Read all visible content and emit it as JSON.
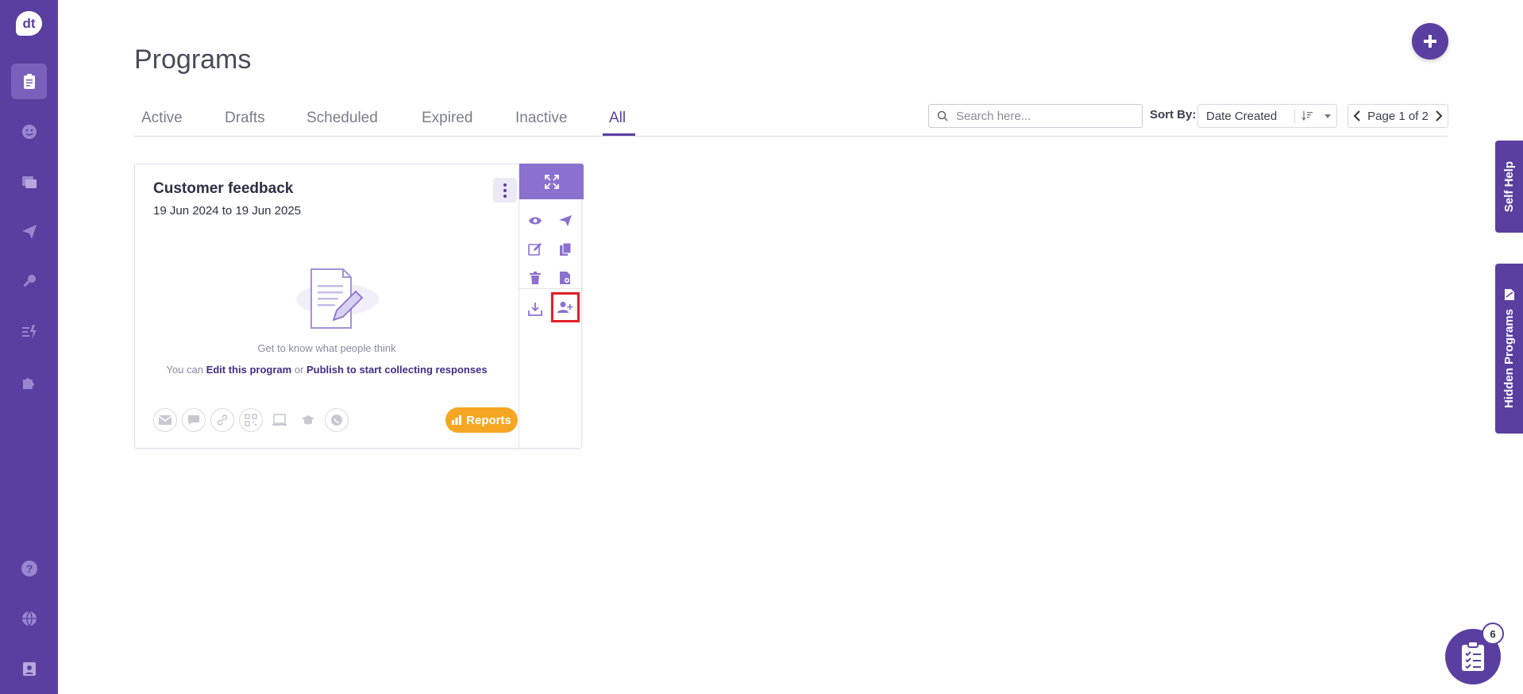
{
  "sidebar": {
    "logo_text": "dt",
    "items": [
      {
        "icon": "clipboard-icon",
        "active": true
      },
      {
        "icon": "smiley-icon"
      },
      {
        "icon": "gallery-icon"
      },
      {
        "icon": "paper-plane-icon"
      },
      {
        "icon": "key-icon"
      },
      {
        "icon": "automation-icon"
      },
      {
        "icon": "puzzle-icon"
      }
    ],
    "bottom_items": [
      {
        "icon": "help-icon"
      },
      {
        "icon": "globe-icon"
      },
      {
        "icon": "profile-icon"
      }
    ]
  },
  "page": {
    "title": "Programs"
  },
  "tabs": [
    {
      "label": "Active"
    },
    {
      "label": "Drafts"
    },
    {
      "label": "Scheduled"
    },
    {
      "label": "Expired"
    },
    {
      "label": "Inactive"
    },
    {
      "label": "All",
      "active": true
    }
  ],
  "toolbar": {
    "search_placeholder": "Search here...",
    "sort_label": "Sort By:",
    "sort_value": "Date Created",
    "pager_text": "Page 1 of 2"
  },
  "card": {
    "title": "Customer feedback",
    "date_start": "19 Jun 2024",
    "date_to": "to",
    "date_end": "19 Jun 2025",
    "description": "Get to know what people think",
    "cta_prefix": "You can",
    "cta_edit": "Edit this program",
    "cta_or": "or",
    "cta_publish": "Publish to start collecting responses",
    "reports_label": "Reports",
    "channels": [
      "email-icon",
      "sms-icon",
      "link-icon",
      "qr-code-icon",
      "kiosk-icon",
      "lms-icon",
      "whatsapp-icon"
    ],
    "actions": [
      "expand-icon",
      "preview-icon",
      "send-icon",
      "edit-icon",
      "copy-icon",
      "delete-icon",
      "settings-doc-icon",
      "download-icon",
      "add-user-icon"
    ]
  },
  "side_tabs": {
    "self_help": "Self Help",
    "hidden_programs": "Hidden Programs"
  },
  "tasks": {
    "badge_count": "6"
  },
  "colors": {
    "primary": "#5b3fa0",
    "accent_light": "#8b71cf",
    "reports": "#f5a623",
    "highlight": "#e01f2a"
  }
}
